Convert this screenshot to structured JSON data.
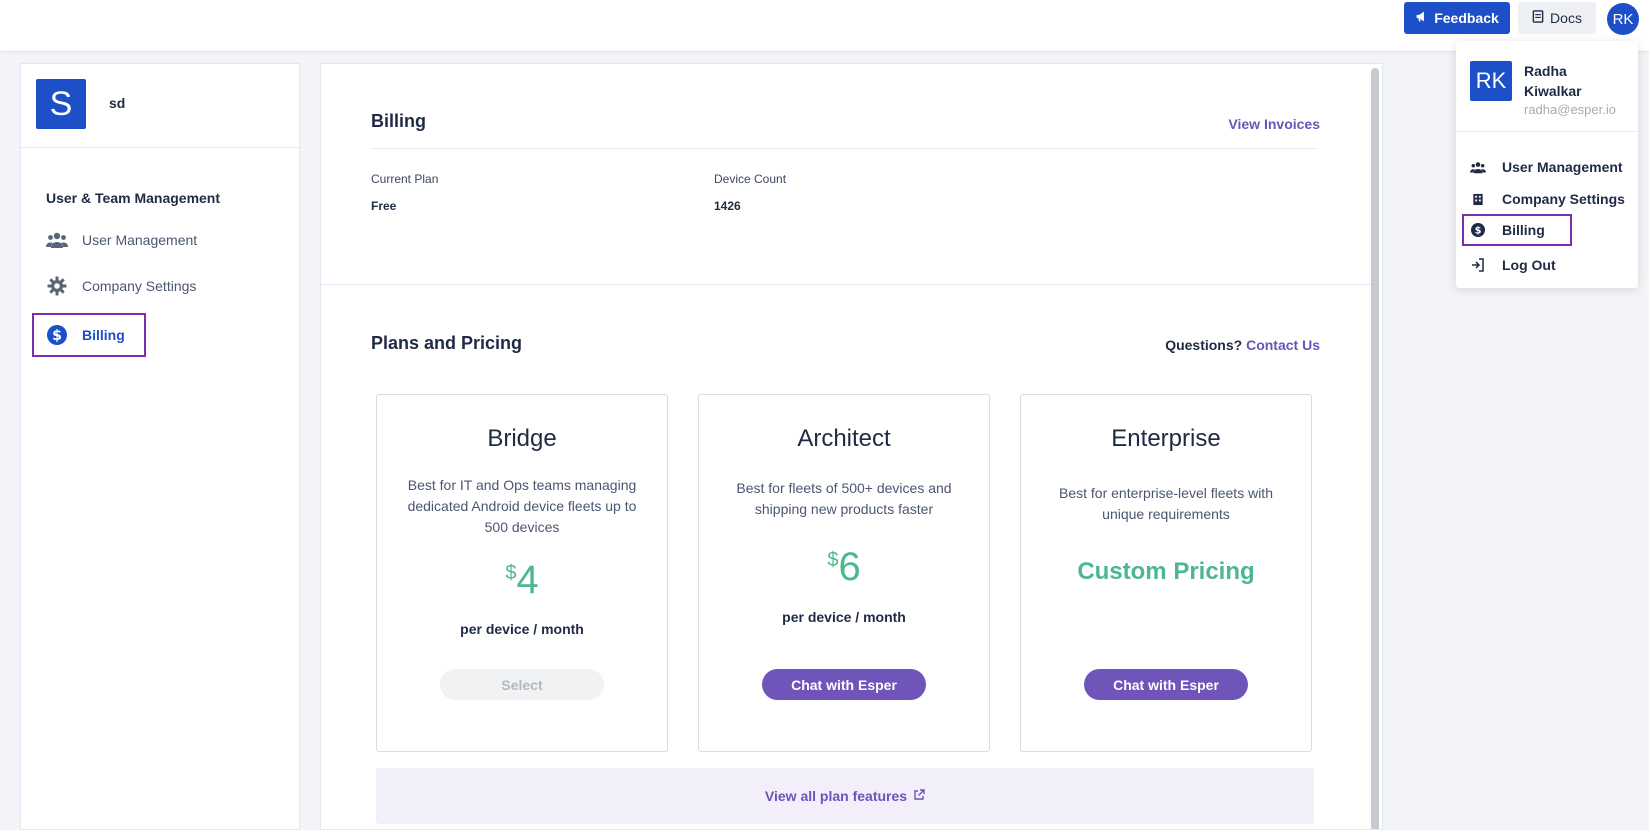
{
  "topbar": {
    "feedback_label": "Feedback",
    "docs_label": "Docs",
    "avatar_initials": "RK"
  },
  "sidebar": {
    "org_initial": "S",
    "org_name": "sd",
    "section_title": "User & Team Management",
    "items": [
      {
        "label": "User Management",
        "icon": "users-icon"
      },
      {
        "label": "Company Settings",
        "icon": "gear-icon"
      },
      {
        "label": "Billing",
        "icon": "dollar-circle-icon",
        "active": true
      }
    ]
  },
  "billing": {
    "title": "Billing",
    "view_invoices": "View Invoices",
    "current_plan_label": "Current Plan",
    "current_plan_value": "Free",
    "device_count_label": "Device Count",
    "device_count_value": "1426"
  },
  "plans": {
    "title": "Plans and Pricing",
    "questions_label": "Questions?",
    "contact_label": "Contact Us",
    "currency_symbol": "$",
    "cards": [
      {
        "name": "Bridge",
        "description": "Best for IT and Ops teams managing dedicated Android device fleets up to 500 devices",
        "price": "4",
        "per": "per device / month",
        "button": "Select"
      },
      {
        "name": "Architect",
        "description": "Best for fleets of 500+ devices and shipping new products faster",
        "price": "6",
        "per": "per device / month",
        "button": "Chat with Esper"
      },
      {
        "name": "Enterprise",
        "description": "Best for enterprise-level fleets with unique requirements",
        "price": "Custom Pricing",
        "button": "Chat with Esper"
      }
    ],
    "view_all_features": "View all plan features"
  },
  "user_menu": {
    "avatar_initials": "RK",
    "name": "Radha Kiwalkar",
    "email": "radha@esper.io",
    "items": [
      {
        "label": "User Management",
        "icon": "users-icon"
      },
      {
        "label": "Company Settings",
        "icon": "building-icon"
      },
      {
        "label": "Billing",
        "icon": "dollar-circle-icon",
        "active": true
      },
      {
        "label": "Log Out",
        "icon": "logout-icon"
      }
    ]
  },
  "colors": {
    "brand_blue": "#1d50c8",
    "accent_purple": "#6f55b9",
    "price_green": "#4cb88d",
    "highlight_border": "#7a2fb0"
  }
}
